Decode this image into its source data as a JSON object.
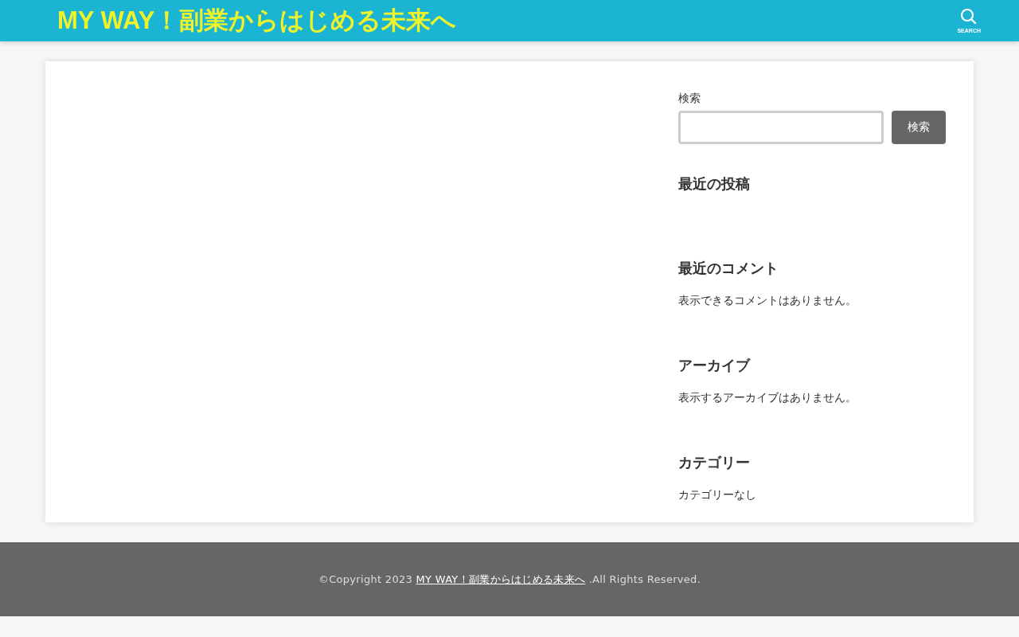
{
  "header": {
    "logo": "MY WAY！副業からはじめる未来へ",
    "search_label": "SEARCH"
  },
  "search_widget": {
    "label": "検索",
    "button": "検索"
  },
  "widgets": [
    {
      "title": "最近の投稿"
    },
    {
      "title": "最近のコメント",
      "text": "表示できるコメントはありません。"
    },
    {
      "title": "アーカイブ",
      "text": "表示するアーカイブはありません。"
    },
    {
      "title": "カテゴリー",
      "text": "カテゴリーなし"
    }
  ],
  "footer": {
    "prefix": "©Copyright 2023 ",
    "link": "MY WAY！副業からはじめる未来へ",
    "suffix": " .All Rights Reserved."
  }
}
